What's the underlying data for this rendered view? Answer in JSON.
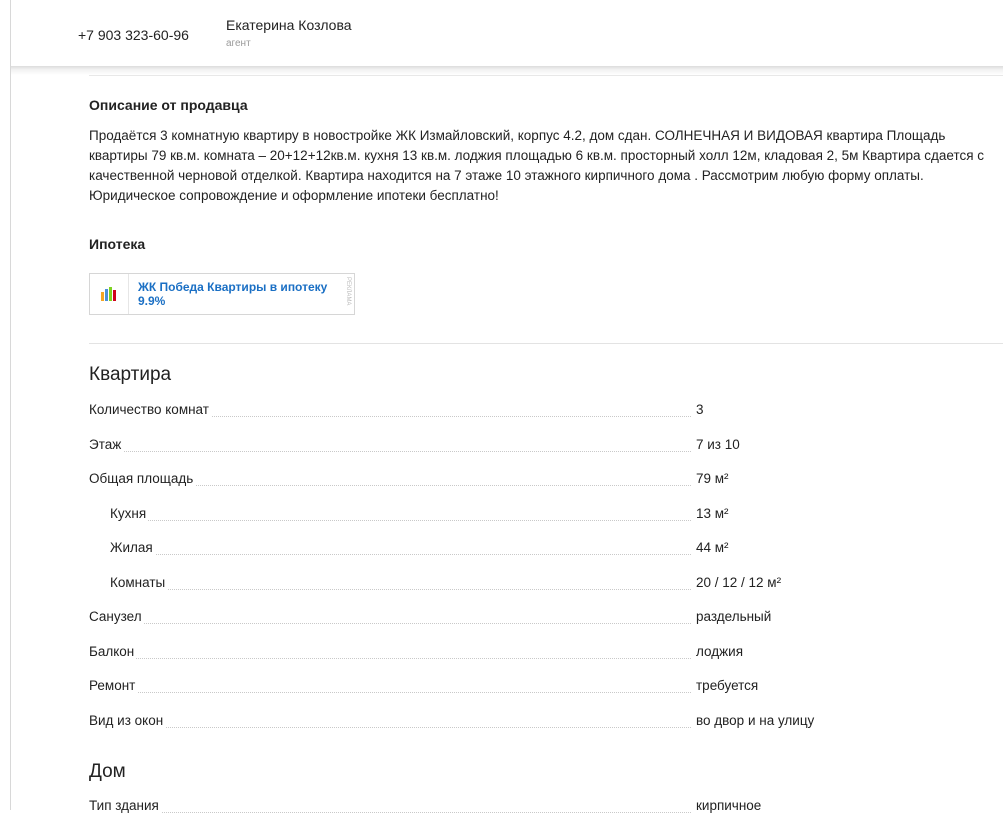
{
  "header": {
    "phone": "+7 903 323-60-96",
    "agent_name": "Екатерина Козлова",
    "agent_role": "агент"
  },
  "description": {
    "title": "Описание от продавца",
    "text": "Продаётся 3 комнатную квартиру в новостройке ЖК Измайловский, корпус 4.2, дом сдан. СОЛНЕЧНАЯ И ВИДОВАЯ квартира Площадь квартиры 79 кв.м. комната – 20+12+12кв.м. кухня 13 кв.м. лоджия площадью 6 кв.м. просторный холл 12м, кладовая 2, 5м Квартира сдается с качественной черновой отделкой. Квартира находится на 7 этаже 10 этажного кирпичного дома . Рассмотрим любую форму оплаты. Юридическое сопровождение и оформление ипотеки бесплатно!"
  },
  "mortgage": {
    "title": "Ипотека",
    "ad_text": "ЖК Победа Квартиры в ипотеку 9.9%",
    "ad_label": "РЕКЛАМА",
    "logo_colors": [
      "#f5a623",
      "#4a90d9",
      "#7ed321",
      "#d0021b"
    ]
  },
  "apartment": {
    "title": "Квартира",
    "rows": [
      {
        "label": "Количество комнат",
        "value": "3"
      },
      {
        "label": "Этаж",
        "value": "7 из 10"
      },
      {
        "label": "Общая площадь",
        "value": "79 м²"
      },
      {
        "label": "Кухня",
        "value": "13 м²"
      },
      {
        "label": "Жилая",
        "value": "44 м²"
      },
      {
        "label": "Комнаты",
        "value": "20 / 12 / 12 м²"
      },
      {
        "label": "Санузел",
        "value": "раздельный"
      },
      {
        "label": "Балкон",
        "value": "лоджия"
      },
      {
        "label": "Ремонт",
        "value": "требуется"
      },
      {
        "label": "Вид из окон",
        "value": "во двор и на улицу"
      }
    ]
  },
  "house": {
    "title": "Дом",
    "rows": [
      {
        "label": "Тип здания",
        "value": "кирпичное"
      }
    ]
  }
}
